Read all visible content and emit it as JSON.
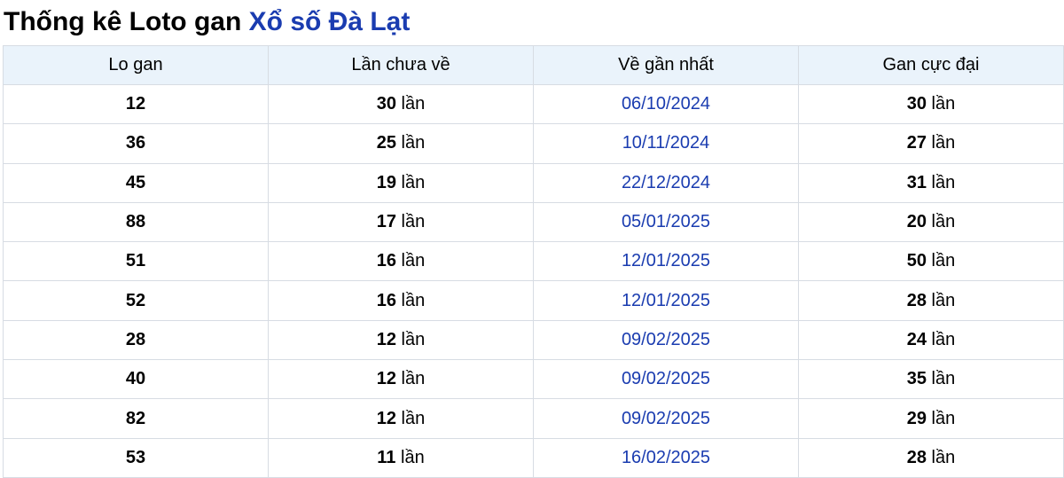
{
  "title": {
    "prefix": "Thống kê Loto gan",
    "highlight": "Xổ số Đà Lạt"
  },
  "table": {
    "headers": [
      "Lo gan",
      "Lần chưa về",
      "Về gần nhất",
      "Gan cực đại"
    ],
    "unit": "lần",
    "rows": [
      {
        "lo": "12",
        "chua_ve": "30",
        "ve_gan_nhat": "06/10/2024",
        "cuc_dai": "30"
      },
      {
        "lo": "36",
        "chua_ve": "25",
        "ve_gan_nhat": "10/11/2024",
        "cuc_dai": "27"
      },
      {
        "lo": "45",
        "chua_ve": "19",
        "ve_gan_nhat": "22/12/2024",
        "cuc_dai": "31"
      },
      {
        "lo": "88",
        "chua_ve": "17",
        "ve_gan_nhat": "05/01/2025",
        "cuc_dai": "20"
      },
      {
        "lo": "51",
        "chua_ve": "16",
        "ve_gan_nhat": "12/01/2025",
        "cuc_dai": "50"
      },
      {
        "lo": "52",
        "chua_ve": "16",
        "ve_gan_nhat": "12/01/2025",
        "cuc_dai": "28"
      },
      {
        "lo": "28",
        "chua_ve": "12",
        "ve_gan_nhat": "09/02/2025",
        "cuc_dai": "24"
      },
      {
        "lo": "40",
        "chua_ve": "12",
        "ve_gan_nhat": "09/02/2025",
        "cuc_dai": "35"
      },
      {
        "lo": "82",
        "chua_ve": "12",
        "ve_gan_nhat": "09/02/2025",
        "cuc_dai": "29"
      },
      {
        "lo": "53",
        "chua_ve": "11",
        "ve_gan_nhat": "16/02/2025",
        "cuc_dai": "28"
      }
    ]
  },
  "colors": {
    "accent": "#1a3cb0",
    "header_bg": "#eaf3fb",
    "border": "#d7dce3"
  }
}
